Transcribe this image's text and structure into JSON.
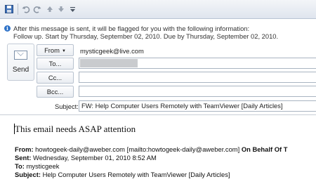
{
  "quick_access": {
    "icons": [
      "save-icon",
      "undo-icon",
      "redo-icon",
      "up-arrow-icon",
      "down-arrow-icon",
      "customize-icon"
    ]
  },
  "infobar": {
    "line1": "After this message is sent, it will be flagged for you with the following information:",
    "line2": "Follow up.  Start by Thursday, September 02, 2010.  Due by Thursday, September 02, 2010."
  },
  "compose": {
    "send_label": "Send",
    "from_label": "From",
    "from_value": "mysticgeek@live.com",
    "to_label": "To...",
    "cc_label": "Cc...",
    "bcc_label": "Bcc...",
    "subject_label": "Subject:",
    "subject_value": "FW: Help Computer Users Remotely with TeamViewer [Daily Articles]"
  },
  "body": {
    "note": "This email needs ASAP attention",
    "fwd_from_label": "From:",
    "fwd_from_value": " howtogeek-daily@aweber.com [mailto:howtogeek-daily@aweber.com] ",
    "fwd_behalf": "On Behalf Of T",
    "fwd_sent_label": "Sent:",
    "fwd_sent_value": " Wednesday, September 01, 2010 8:52 AM",
    "fwd_to_label": "To:",
    "fwd_to_value": " mysticgeek",
    "fwd_subject_label": "Subject:",
    "fwd_subject_value": " Help Computer Users Remotely with TeamViewer [Daily Articles]"
  }
}
